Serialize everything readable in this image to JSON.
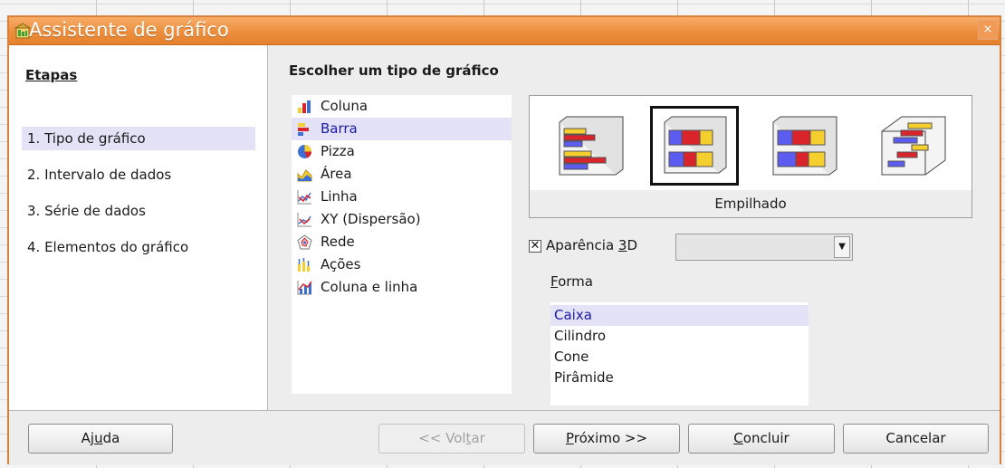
{
  "window": {
    "title": "Assistente de gráfico",
    "close_glyph": "×"
  },
  "steps": {
    "title": "Etapas",
    "items": [
      {
        "label": "1. Tipo de gráfico",
        "active": true
      },
      {
        "label": "2. Intervalo de dados",
        "active": false
      },
      {
        "label": "3. Série de dados",
        "active": false
      },
      {
        "label": "4. Elementos do gráfico",
        "active": false
      }
    ]
  },
  "main": {
    "heading": "Escolher um tipo de gráfico",
    "chart_types": [
      {
        "label": "Coluna",
        "icon": "column-chart-icon"
      },
      {
        "label": "Barra",
        "icon": "bar-chart-icon",
        "selected": true
      },
      {
        "label": "Pizza",
        "icon": "pie-chart-icon"
      },
      {
        "label": "Área",
        "icon": "area-chart-icon"
      },
      {
        "label": "Linha",
        "icon": "line-chart-icon"
      },
      {
        "label": "XY (Dispersão)",
        "icon": "xy-scatter-chart-icon"
      },
      {
        "label": "Rede",
        "icon": "net-chart-icon"
      },
      {
        "label": "Ações",
        "icon": "stock-chart-icon"
      },
      {
        "label": "Coluna e linha",
        "icon": "column-line-chart-icon"
      }
    ],
    "variant_caption": "Empilhado",
    "variants": [
      {
        "icon": "bar-normal-3d-icon"
      },
      {
        "icon": "bar-stacked-3d-icon",
        "selected": true
      },
      {
        "icon": "bar-percent-stacked-3d-icon"
      },
      {
        "icon": "bar-deep-3d-icon"
      }
    ],
    "appearance_3d": {
      "label_pre": "Aparência ",
      "mnemonic": "3",
      "label_post": "D",
      "checked": true,
      "combo_value": ""
    },
    "shape": {
      "label_mnemonic": "F",
      "label_rest": "orma",
      "options": [
        "Caixa",
        "Cilindro",
        "Cone",
        "Pirâmide"
      ],
      "selected": "Caixa"
    }
  },
  "footer": {
    "help": {
      "pre": "Aj",
      "mn": "u",
      "post": "da"
    },
    "back": {
      "pre": "<< Vol",
      "mn": "t",
      "post": "ar"
    },
    "next": {
      "pre": "",
      "mn": "P",
      "post": "róximo >>"
    },
    "finish": {
      "pre": "",
      "mn": "C",
      "post": "oncluir"
    },
    "cancel": "Cancelar"
  },
  "colors": {
    "accent_orange": "#ec8e3d",
    "selection": "#e4e2f6",
    "bar_blue": "#5c5cf0",
    "bar_red": "#d9242b",
    "bar_yellow": "#f4cf2e"
  }
}
